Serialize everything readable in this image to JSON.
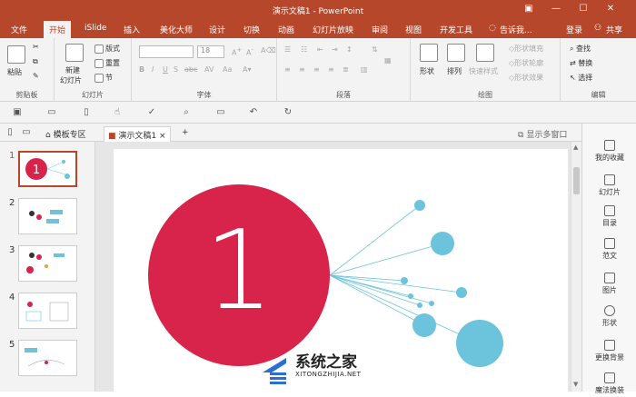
{
  "window": {
    "title": "演示文稿1 - PowerPoint",
    "controls": [
      "▣",
      "—",
      "☐",
      "✕"
    ]
  },
  "menu_tabs": [
    "文件",
    "开始",
    "iSlide",
    "插入",
    "美化大师",
    "设计",
    "切换",
    "动画",
    "幻灯片放映",
    "审阅",
    "视图",
    "开发工具"
  ],
  "active_tab": "开始",
  "tell_me": "告诉我...",
  "login": "登录",
  "share": "共享",
  "ribbon": {
    "clipboard": {
      "label": "剪贴板",
      "paste": "粘贴"
    },
    "slides": {
      "label": "幻灯片",
      "new_slide_1": "新建",
      "new_slide_2": "幻灯片",
      "layout": "版式",
      "reset": "重置",
      "section": "节"
    },
    "font": {
      "label": "字体",
      "font_size": "18"
    },
    "paragraph": {
      "label": "段落"
    },
    "drawing": {
      "label": "绘图",
      "shapes": "形状",
      "arrange": "排列",
      "quick_styles": "快速样式",
      "fill": "形状填充",
      "outline": "形状轮廓",
      "effects": "形状效果"
    },
    "editing": {
      "label": "编辑",
      "find": "查找",
      "replace": "替换",
      "select": "选择"
    }
  },
  "doc_tabs": {
    "templates": "模板专区",
    "document": "演示文稿1",
    "multi_window": "显示多窗口"
  },
  "slides": [
    {
      "number": "1"
    },
    {
      "number": "2"
    },
    {
      "number": "3"
    },
    {
      "number": "4"
    },
    {
      "number": "5"
    }
  ],
  "slide_main": {
    "big_number": "1"
  },
  "right_pane": [
    "我的收藏",
    "幻灯片",
    "目录",
    "范文",
    "图片",
    "形状",
    "更换背景",
    "魔法换装"
  ],
  "watermark": {
    "title": "系统之家",
    "url": "XITONGZHIJIA.NET"
  },
  "colors": {
    "accent": "#b7472a",
    "circle_red": "#d8234a",
    "bubble_blue": "#6cc3dc"
  }
}
